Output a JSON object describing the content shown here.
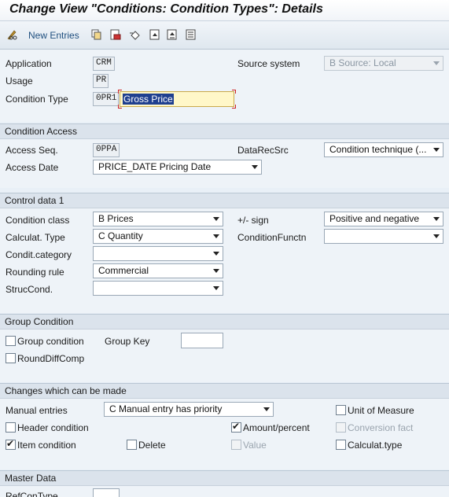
{
  "window": {
    "title": "Change View \"Conditions: Condition Types\": Details"
  },
  "toolbar": {
    "new_entries_label": "New Entries"
  },
  "header": {
    "application_label": "Application",
    "application_value": "CRM",
    "usage_label": "Usage",
    "usage_value": "PR",
    "condition_type_label": "Condition Type",
    "condition_type_value": "0PR1",
    "condition_type_text": "Gross Price",
    "source_system_label": "Source system",
    "source_system_value": "B Source: Local"
  },
  "condition_access": {
    "header": "Condition Access",
    "access_seq_label": "Access Seq.",
    "access_seq_value": "0PPA",
    "datarecsrc_label": "DataRecSrc",
    "datarecsrc_value": "Condition technique (...",
    "access_date_label": "Access Date",
    "access_date_value": "PRICE_DATE Pricing Date"
  },
  "control_data": {
    "header": "Control data 1",
    "condition_class_label": "Condition class",
    "condition_class_value": "B Prices",
    "calc_type_label": "Calculat. Type",
    "calc_type_value": "C Quantity",
    "condit_category_label": "Condit.category",
    "condit_category_value": "",
    "rounding_rule_label": "Rounding rule",
    "rounding_rule_value": "Commercial",
    "struccond_label": "StrucCond.",
    "struccond_value": "",
    "sign_label": "+/- sign",
    "sign_value": "Positive and negative",
    "condfunctn_label": "ConditionFunctn",
    "condfunctn_value": ""
  },
  "group_condition": {
    "header": "Group Condition",
    "group_condition_label": "Group condition",
    "group_condition_checked": false,
    "group_key_label": "Group Key",
    "group_key_value": "",
    "rounddiffcomp_label": "RoundDiffComp",
    "rounddiffcomp_checked": false
  },
  "changes": {
    "header": "Changes which can be made",
    "manual_entries_label": "Manual entries",
    "manual_entries_value": "C Manual entry has priority",
    "unit_of_measure_label": "Unit of Measure",
    "unit_of_measure_checked": false,
    "header_condition_label": "Header condition",
    "header_condition_checked": false,
    "amount_percent_label": "Amount/percent",
    "amount_percent_checked": true,
    "conversion_fact_label": "Conversion fact",
    "conversion_fact_checked": false,
    "item_condition_label": "Item condition",
    "item_condition_checked": true,
    "delete_label": "Delete",
    "delete_checked": false,
    "value_label": "Value",
    "value_checked": false,
    "calculat_type_label": "Calculat.type",
    "calculat_type_checked": false
  },
  "master_data": {
    "header": "Master Data",
    "refcontype_label": "RefConType",
    "refcontype_value": ""
  },
  "colors": {
    "accent": "#1f3f8f",
    "section_bg": "#dbe3ec",
    "body_bg": "#e9f0f7"
  },
  "icons": [
    "pencil-glasses-icon",
    "copy-icon",
    "delete-icon",
    "undo-icon",
    "first-entry-icon",
    "previous-entry-icon",
    "next-entry-icon"
  ]
}
